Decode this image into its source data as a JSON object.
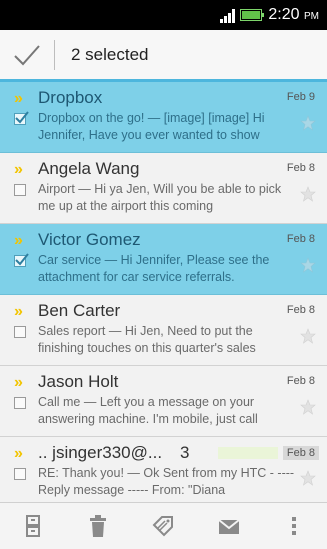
{
  "status_bar": {
    "time": "2:20",
    "ampm": "PM"
  },
  "action_bar": {
    "selected_label": "2 selected"
  },
  "emails": [
    {
      "sender": "Dropbox",
      "date": "Feb 9",
      "preview": "Dropbox on the go! — [image] [image] Hi Jennifer, Have you ever wanted to show",
      "selected": true
    },
    {
      "sender": "Angela Wang",
      "date": "Feb 8",
      "preview": "Airport — Hi ya Jen, Will you be able to pick me up at the airport this coming",
      "selected": false
    },
    {
      "sender": "Victor Gomez",
      "date": "Feb 8",
      "preview": "Car service — Hi Jennifer, Please see the attachment for car service referrals.",
      "selected": true
    },
    {
      "sender": "Ben Carter",
      "date": "Feb 8",
      "preview": "Sales report — Hi Jen, Need to put the finishing touches on this quarter's sales",
      "selected": false
    },
    {
      "sender": "Jason Holt",
      "date": "Feb 8",
      "preview": "Call me — Left you a message on your answering machine. I'm mobile, just call",
      "selected": false
    },
    {
      "sender": ".. jsinger330@...",
      "count": "3",
      "date": "Feb 8",
      "preview": "RE: Thank you! — Ok Sent from my HTC - ---- Reply message ----- From: \"Diana",
      "selected": false
    }
  ],
  "toolbar": {
    "icons": [
      "archive-icon",
      "delete-icon",
      "label-icon",
      "mark-read-icon",
      "overflow-menu-icon"
    ]
  },
  "colors": {
    "accent": "#4db6dd",
    "selected_row": "#7ed0e8",
    "chevron": "#f2c400"
  }
}
